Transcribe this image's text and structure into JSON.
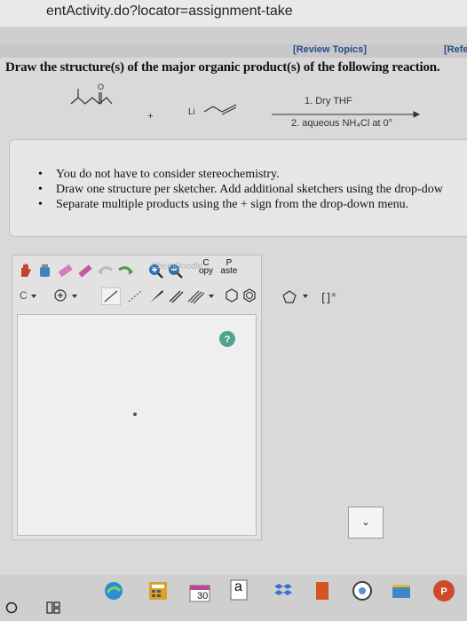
{
  "browser": {
    "url_fragment": "entActivity.do?locator=assignment-take"
  },
  "header": {
    "review_topics": "[Review Topics]",
    "references": "[Refe"
  },
  "question": {
    "text": "Draw the structure(s) of the major organic product(s) of the following reaction."
  },
  "reaction": {
    "plus": "+",
    "reagent_atom": "Li",
    "condition_1": "1. Dry THF",
    "condition_2": "2. aqueous NH₄Cl at 0°",
    "ketone_oxygen": "O"
  },
  "instructions": [
    "You do not have to consider stereochemistry.",
    "Draw one structure per sketcher. Add additional sketchers using the drop-dow",
    "Separate multiple products using the + sign from the drop-down menu."
  ],
  "sketcher": {
    "copy_label": "C\nopy",
    "paste_label": "P\naste",
    "element_label": "C",
    "brand": "ChemDoodle"
  },
  "add_sketcher": {
    "label": "⌄"
  },
  "taskbar": {
    "badge_count": "30",
    "a_label": "a"
  }
}
